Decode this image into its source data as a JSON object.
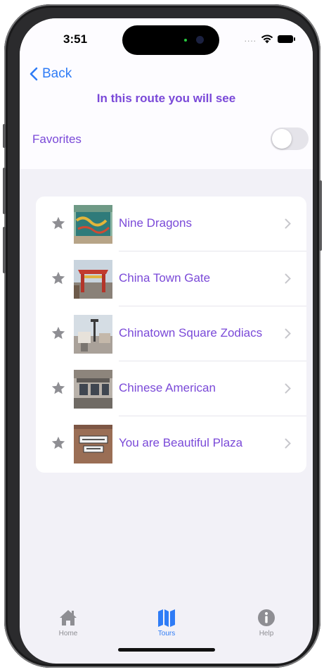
{
  "status": {
    "time": "3:51",
    "signal": "...."
  },
  "nav": {
    "back_label": "Back",
    "title": "In this route you will see"
  },
  "favorites": {
    "label": "Favorites",
    "enabled": false
  },
  "places": [
    {
      "name": "Nine Dragons"
    },
    {
      "name": "China Town Gate"
    },
    {
      "name": "Chinatown Square Zodiacs"
    },
    {
      "name": "Chinese American"
    },
    {
      "name": "You are Beautiful Plaza"
    }
  ],
  "tabs": [
    {
      "label": "Home",
      "icon": "house-icon",
      "active": false
    },
    {
      "label": "Tours",
      "icon": "map-icon",
      "active": true
    },
    {
      "label": "Help",
      "icon": "info-circle-icon",
      "active": false
    }
  ],
  "colors": {
    "accent": "#7a49d8",
    "link": "#2f7cf6",
    "tab_active": "#2f7cf6",
    "tab_inactive": "#8e8e93"
  }
}
